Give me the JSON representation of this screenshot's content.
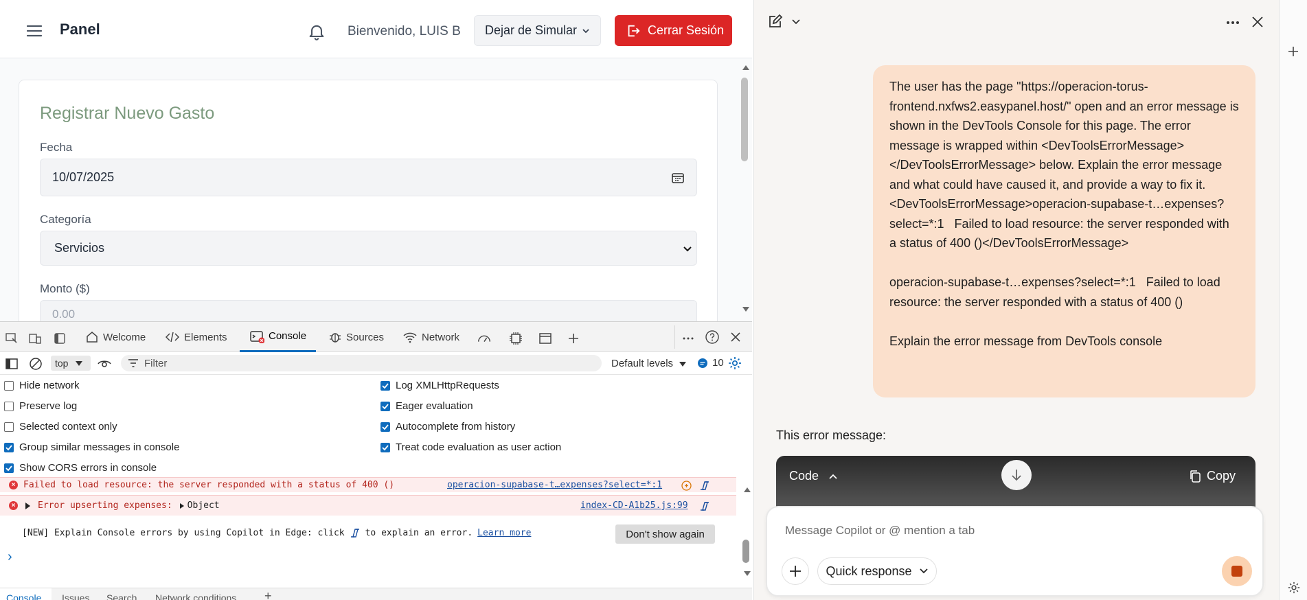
{
  "app": {
    "title": "Panel",
    "welcome": "Bienvenido, LUIS B",
    "simulate_button": "Dejar de Simular",
    "logout_button": "Cerrar Sesión",
    "form": {
      "title": "Registrar Nuevo Gasto",
      "date_label": "Fecha",
      "date_value": "10/07/2025",
      "category_label": "Categoría",
      "category_value": "Servicios",
      "amount_label": "Monto ($)",
      "amount_placeholder": "0.00"
    }
  },
  "devtools": {
    "tabs": [
      "Welcome",
      "Elements",
      "Console",
      "Sources",
      "Network"
    ],
    "active_tab": "Console",
    "context": "top",
    "filter_placeholder": "Filter",
    "levels": "Default levels",
    "issue_count": "10",
    "settings_left": [
      {
        "label": "Hide network",
        "checked": false
      },
      {
        "label": "Preserve log",
        "checked": false
      },
      {
        "label": "Selected context only",
        "checked": false
      },
      {
        "label": "Group similar messages in console",
        "checked": true
      },
      {
        "label": "Show CORS errors in console",
        "checked": true
      }
    ],
    "settings_right": [
      {
        "label": "Log XMLHttpRequests",
        "checked": true
      },
      {
        "label": "Eager evaluation",
        "checked": true
      },
      {
        "label": "Autocomplete from history",
        "checked": true
      },
      {
        "label": "Treat code evaluation as user action",
        "checked": true
      }
    ],
    "messages": [
      {
        "text": "Failed to load resource: the server responded with a status of 400 ()",
        "source": "operacion-supabase-t…expenses?select=*:1"
      },
      {
        "text": "Error upserting expenses:",
        "object": "Object",
        "source": "index-CD-A1b25.js:99"
      }
    ],
    "tip": {
      "prefix": "[NEW] Explain Console errors by using Copilot in Edge: click",
      "suffix": "to explain an error.",
      "link": "Learn more",
      "button": "Don't show again"
    },
    "prompt": "›",
    "bottom_tabs": [
      "Console",
      "Issues",
      "Search",
      "Network conditions"
    ]
  },
  "copilot": {
    "user_message": "The user has the page \"https://operacion-torus-frontend.nxfws2.easypanel.host/\" open and an error message is shown in the DevTools Console for this page. The error message is wrapped within <DevToolsErrorMessage></DevToolsErrorMessage> below. Explain the error message and what could have caused it, and provide a way to fix it. <DevToolsErrorMessage>operacion-supabase-t…expenses?select=*:1   Failed to load resource: the server responded with a status of 400 ()</DevToolsErrorMessage>\n\noperacion-supabase-t…expenses?select=*:1   Failed to load resource: the server responded with a status of 400 ()\n\nExplain the error message from DevTools console",
    "response_intro": "This error message:",
    "code_label": "Code",
    "copy_label": "Copy",
    "composer_placeholder": "Message Copilot or @ mention a tab",
    "mode": "Quick response"
  }
}
